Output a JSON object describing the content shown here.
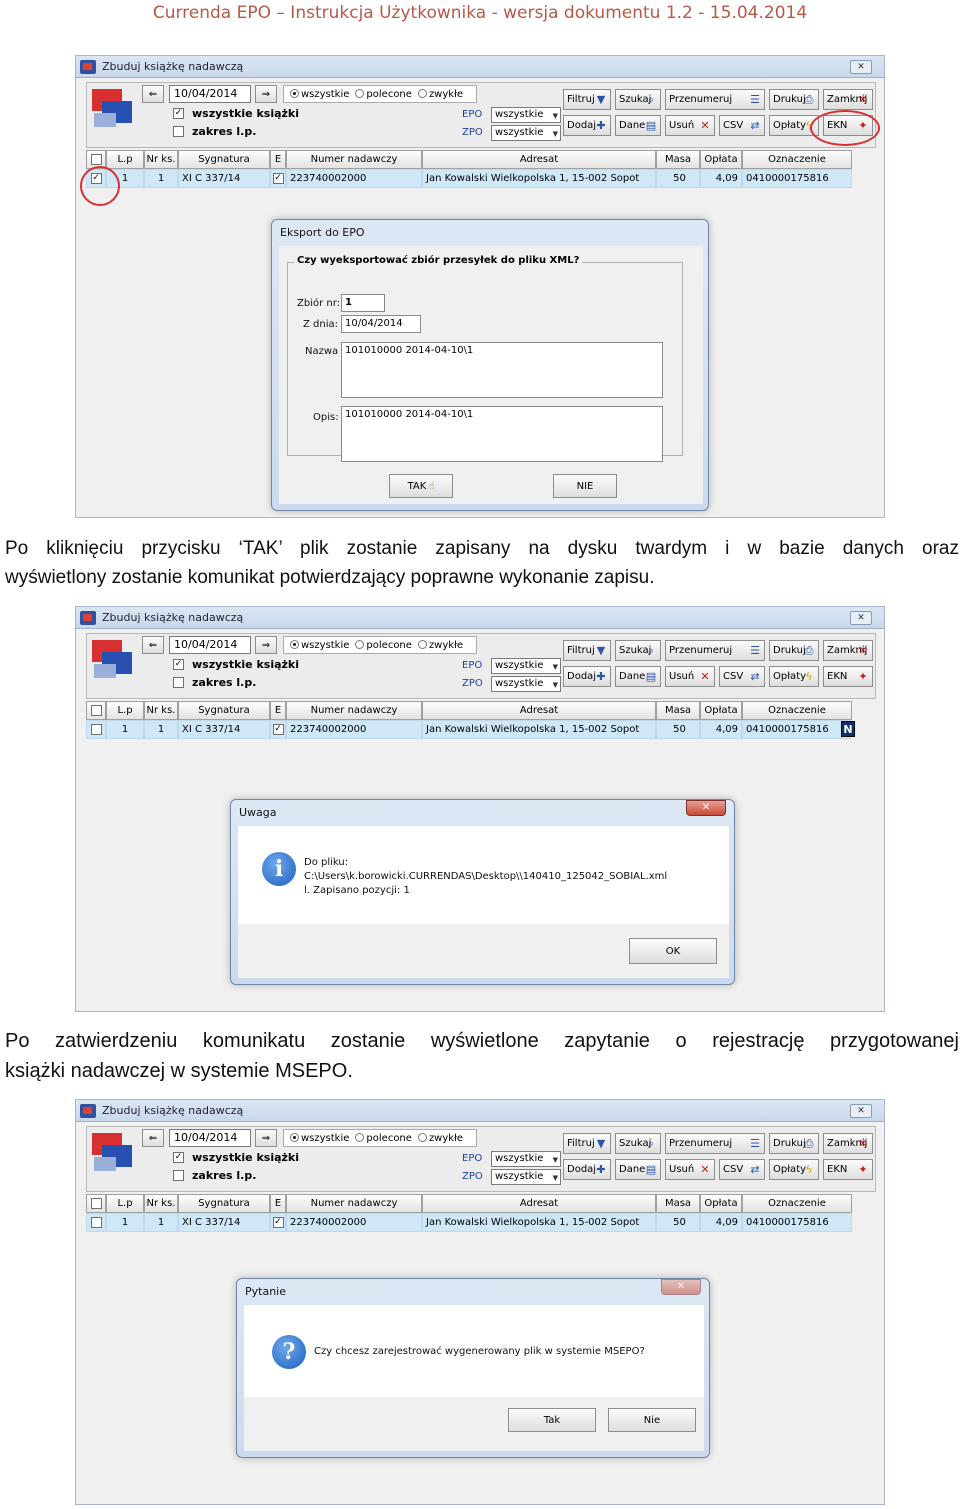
{
  "header": "Currenda EPO – Instrukcja Użytkownika - wersja dokumentu 1.2 - 15.04.2014",
  "paragraph1": [
    "Po kliknięciu przycisku ‘TAK’ plik zostanie zapisany na dysku twardym i w bazie danych oraz",
    "wyświetlony zostanie komunikat potwierdzający poprawne wykonanie zapisu."
  ],
  "paragraph2": [
    "Po zatwierdzeniu komunikatu zostanie wyświetlone zapytanie o rejestrację przygotowanej",
    "książki nadawczej w systemie MSEPO."
  ],
  "window": {
    "title": "Zbuduj książkę nadawczą",
    "close": "✕",
    "date": "10/04/2014",
    "radios": [
      "wszystkie",
      "polecone",
      "zwykłe"
    ],
    "check_all_books": "wszystkie książki",
    "check_range": "zakres l.p.",
    "epo_label": "EPO",
    "zpo_label": "ZPO",
    "epo_value": "wszystkie",
    "zpo_value": "wszystkie",
    "buttons": [
      "Filtruj",
      "Szukaj",
      "Przenumeruj",
      "Drukuj",
      "Zamknij",
      "Dodaj",
      "Dane",
      "Usuń",
      "CSV",
      "Opłaty",
      "EKN"
    ],
    "columns": [
      "L.p",
      "Nr ks.",
      "Sygnatura",
      "E",
      "Numer nadawczy",
      "Adresat",
      "Masa",
      "Opłata",
      "Oznaczenie"
    ],
    "row": {
      "lp": "1",
      "nr": "1",
      "sygnatura": "XI C 337/14",
      "numer": "223740002000",
      "adresat": "Jan Kowalski  Wielkopolska 1, 15-002 Sopot",
      "masa": "50",
      "oplata": "4,09",
      "oznaczenie": "0410000175816"
    },
    "n_badge": "N"
  },
  "export_dialog": {
    "title": "Eksport do EPO",
    "question": "Czy wyeksportować zbiór przesyłek do pliku XML?",
    "zbior_label": "Zbiór nr:",
    "zbior_value": "1",
    "zdnia_label": "Z dnia:",
    "zdnia_value": "10/04/2014",
    "nazwa_label": "Nazwa",
    "nazwa_value": "101010000 2014-04-10\\1",
    "opis_label": "Opis:",
    "opis_value": "101010000 2014-04-10\\1",
    "yes": "TAK",
    "no": "NIE"
  },
  "info_dialog": {
    "title": "Uwaga",
    "close": "✕",
    "line1": "Do pliku:",
    "line2": "C:\\Users\\k.borowicki.CURRENDAS\\Desktop\\\\140410_125042_SOBIAL.xml",
    "line3": "l. Zapisano pozycji: 1",
    "ok": "OK"
  },
  "question_dialog": {
    "title": "Pytanie",
    "close": "✕",
    "text": "Czy chcesz zarejestrować wygenerowany plik w systemie MSEPO?",
    "yes": "Tak",
    "no": "Nie"
  }
}
